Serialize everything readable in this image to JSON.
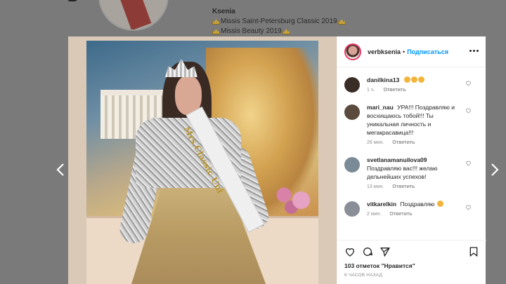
{
  "background_profile": {
    "name": "Ksenia",
    "lines": [
      "Missis Saint-Petersburg Classic 2019",
      "Missis Beauty 2019"
    ]
  },
  "post": {
    "photo_sash_text": "Mrs.Classic Uni",
    "header": {
      "username": "verbksenia",
      "separator": "•",
      "follow_label": "Подписаться"
    },
    "comments": [
      {
        "username": "danilkina13",
        "text": "",
        "emoji_count": 3,
        "time": "1 ч.",
        "reply_label": "Ответить",
        "avatar_color": "#3a2c26"
      },
      {
        "username": "mari_nau",
        "text": "УРА!!! Поздравляю и восхищаюсь тобой!!! Ты уникальная личность и мегакрасавица!!!",
        "emoji_count": 0,
        "time": "26 мин.",
        "reply_label": "Ответить",
        "avatar_color": "#5a4b3e"
      },
      {
        "username": "svetlanamanuilova09",
        "text": "Поздравляю вас!!! желаю дельнейших успехов!",
        "emoji_count": 0,
        "time": "13 мин.",
        "reply_label": "Ответить",
        "avatar_color": "#7a8a96"
      },
      {
        "username": "vitkarelkin",
        "text": "Поздравляю",
        "emoji_count": 1,
        "time": "2 мин.",
        "reply_label": "Ответить",
        "avatar_color": "#8a8f97"
      }
    ],
    "likes_text": "103 отметок \"Нравится\"",
    "time_ago": "6 ЧАСОВ НАЗАД"
  },
  "icons": {
    "heart": "heart-icon",
    "comment": "comment-icon",
    "share": "share-icon",
    "save": "bookmark-icon",
    "prev": "chevron-left-icon",
    "next": "chevron-right-icon"
  },
  "colors": {
    "accent": "#0095f6",
    "story_ring": "#e63a6c",
    "overlay": "#7a7a7a"
  }
}
